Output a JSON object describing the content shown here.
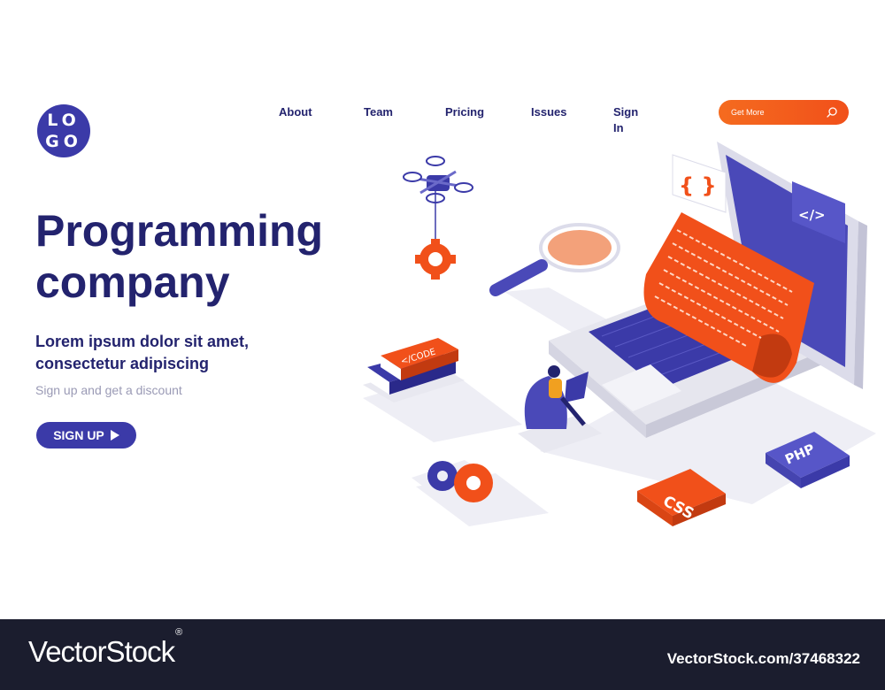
{
  "logo": {
    "line1": "LO",
    "line2": "GO"
  },
  "nav": {
    "items": [
      {
        "label": "About"
      },
      {
        "label": "Team"
      },
      {
        "label": "Pricing"
      },
      {
        "label": "Issues"
      },
      {
        "label": "Sign In"
      }
    ]
  },
  "search": {
    "placeholder": "Get More",
    "icon": "search-icon"
  },
  "hero": {
    "title_line1": "Programming",
    "title_line2": "company",
    "subtitle_line1": "Lorem ipsum dolor sit amet,",
    "subtitle_line2": "consectetur adipiscing",
    "note": "Sign up and get a discount",
    "cta_label": "SIGN UP"
  },
  "illustration": {
    "code_tag": "</CODE",
    "php_label": "PHP",
    "css_label": "CSS",
    "braces_label": "{ }",
    "tag_label": "</>"
  },
  "footer": {
    "brand": "VectorStock",
    "registered": "®",
    "image_id": "VectorStock.com/37468322"
  },
  "colors": {
    "primary": "#3b3aa8",
    "navy_text": "#23236e",
    "accent": "#f1501a",
    "footer_bg": "#1b1d2e"
  }
}
